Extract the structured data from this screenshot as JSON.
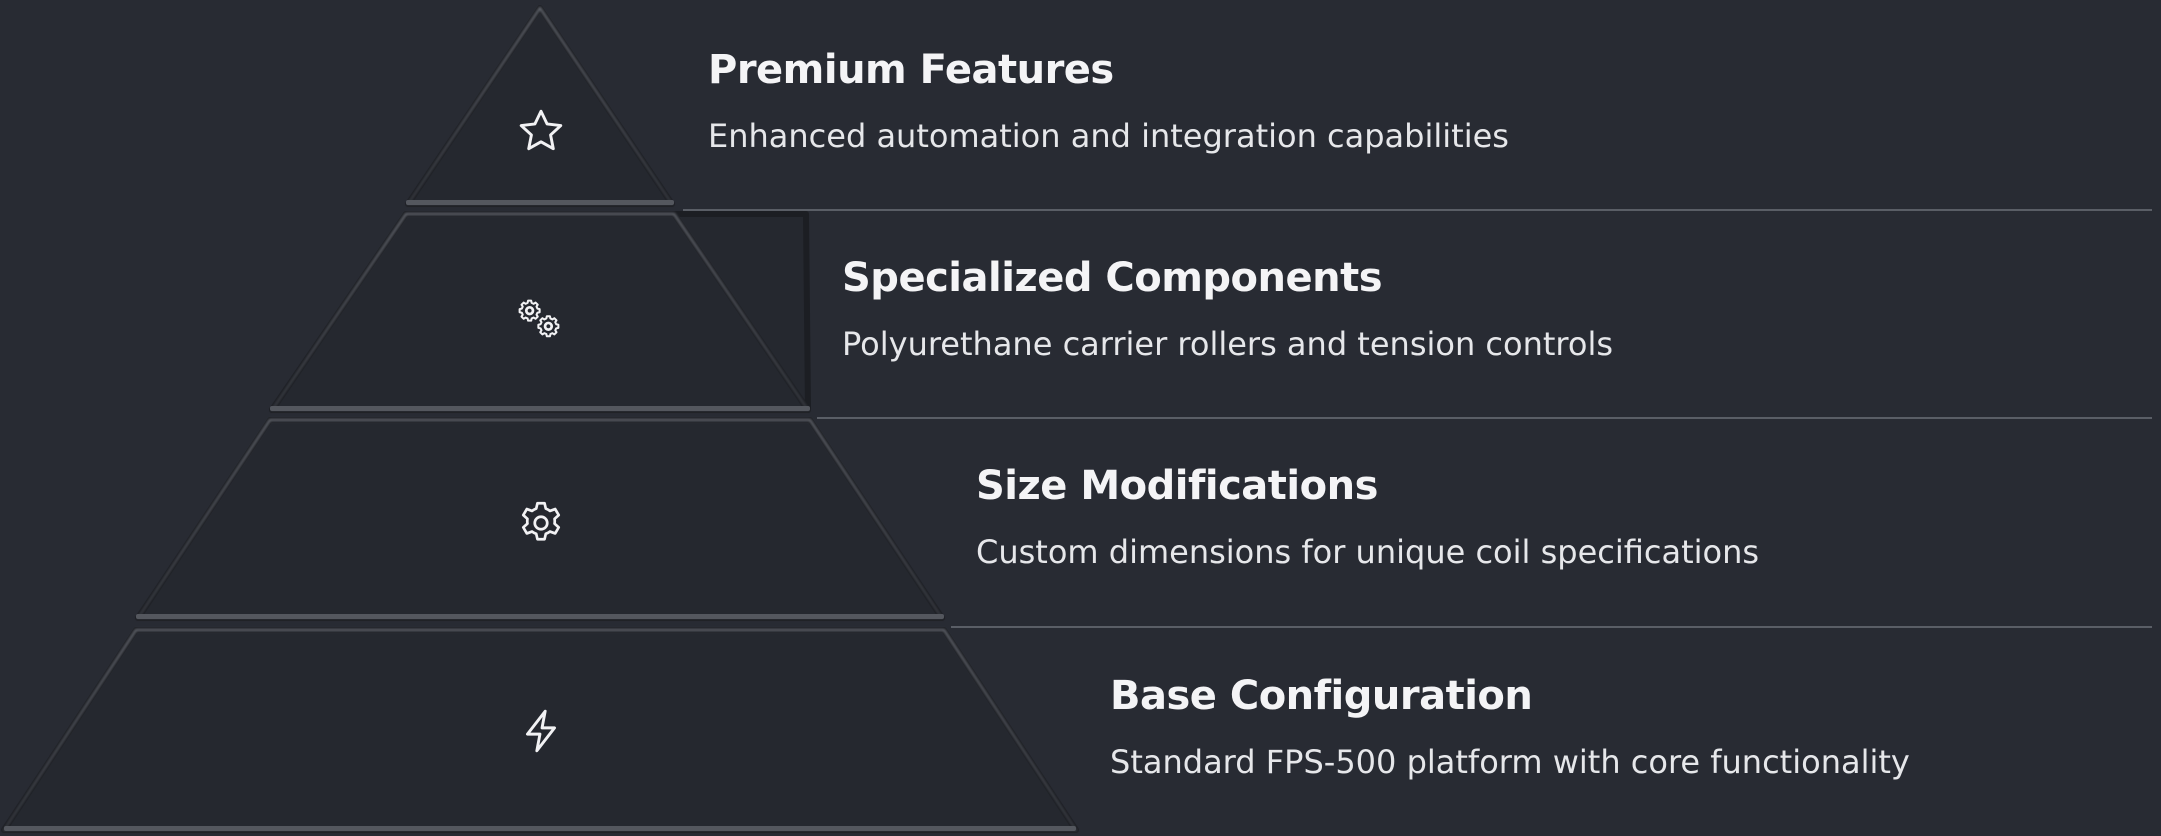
{
  "tiers": [
    {
      "title": "Premium Features",
      "description": "Enhanced automation and integration capabilities",
      "icon": "star-icon"
    },
    {
      "title": "Specialized Components",
      "description": "Polyurethane carrier rollers and tension controls",
      "icon": "gears-icon"
    },
    {
      "title": "Size Modifications",
      "description": "Custom dimensions for unique coil specifications",
      "icon": "gear-icon"
    },
    {
      "title": "Base Configuration",
      "description": "Standard FPS-500 platform with core functionality",
      "icon": "lightning-icon"
    }
  ],
  "colors": {
    "background": "#282b33",
    "tier_fill": "#262930",
    "divider": "#5a5e66",
    "text": "#f4f4f6"
  }
}
